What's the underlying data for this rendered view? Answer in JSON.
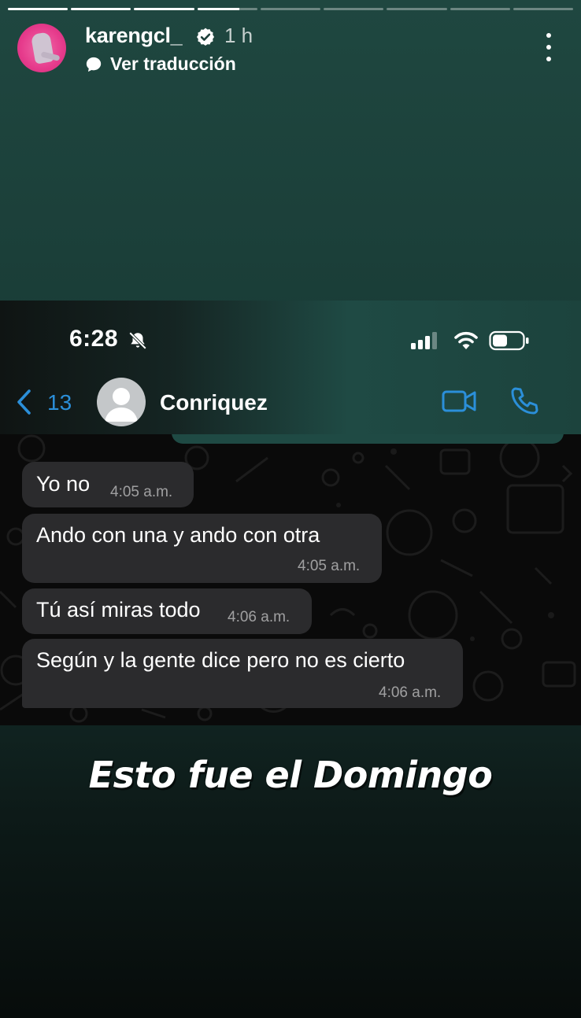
{
  "story": {
    "progress": {
      "total_segments": 9,
      "completed_segments": 3,
      "current_segment_fraction": 0.7
    },
    "username": "karengcl_",
    "verified": true,
    "time_ago": "1 h",
    "translate_label": "Ver traducción",
    "more_icon": "more-vertical-icon",
    "caption": "Esto fue el Domingo"
  },
  "screenshot": {
    "status_bar": {
      "time": "6:28",
      "icons": [
        "bell-slash-icon",
        "signal-icon",
        "wifi-icon",
        "battery-icon"
      ]
    },
    "chat_header": {
      "back_count": "13",
      "contact_name": "Conriquez",
      "icons": [
        "back-chevron-icon",
        "contact-avatar",
        "video-call-icon",
        "phone-call-icon"
      ]
    },
    "messages": [
      {
        "text": "Yo no",
        "time": "4:05 a.m."
      },
      {
        "text": "Ando con una y ando con otra",
        "time": "4:05 a.m."
      },
      {
        "text": "Tú así miras todo",
        "time": "4:06 a.m."
      },
      {
        "text": "Según y la gente dice pero no es cierto",
        "time": "4:06 a.m."
      }
    ]
  },
  "colors": {
    "link_blue": "#2b8fd9",
    "bubble": "#2b2b2d",
    "whatsapp_header": "#1f4a44"
  }
}
